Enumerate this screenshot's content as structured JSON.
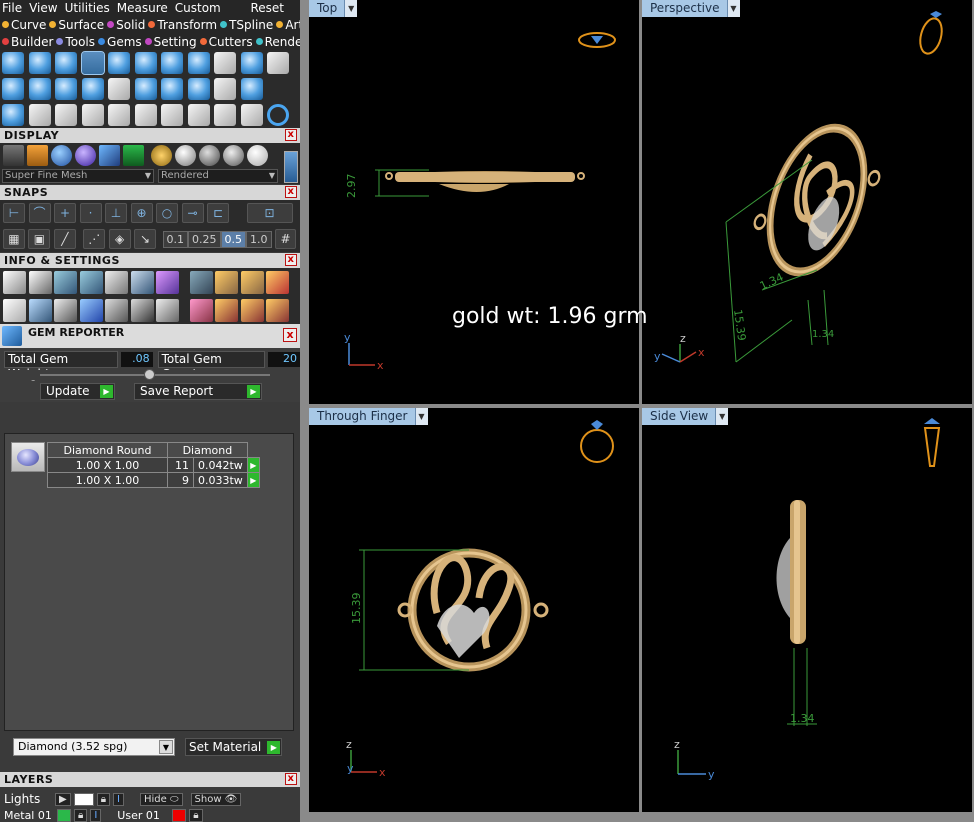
{
  "menubar": {
    "items": [
      "File",
      "View",
      "Utilities",
      "Measure",
      "Custom"
    ],
    "reset": "Reset"
  },
  "commands_row1": [
    {
      "label": "Curve",
      "color": "#f2b233"
    },
    {
      "label": "Surface",
      "color": "#f2b233"
    },
    {
      "label": "Solid",
      "color": "#c248c2"
    },
    {
      "label": "Transform",
      "color": "#f2693a"
    },
    {
      "label": "TSpline",
      "color": "#3fc1c9"
    },
    {
      "label": "Art",
      "color": "#f2b233"
    }
  ],
  "commands_row2": [
    {
      "label": "Builder",
      "color": "#e24040"
    },
    {
      "label": "Tools",
      "color": "#8a8ae0"
    },
    {
      "label": "Gems",
      "color": "#3a8ae0"
    },
    {
      "label": "Setting",
      "color": "#c248c2"
    },
    {
      "label": "Cutters",
      "color": "#f2693a"
    },
    {
      "label": "Render",
      "color": "#3fc1c9"
    }
  ],
  "display": {
    "title": "DISPLAY",
    "mesh_select": "Super Fine Mesh",
    "render_select": "Rendered"
  },
  "snaps": {
    "title": "SNAPS",
    "values": [
      "0.1",
      "0.25",
      "0.5",
      "1.0"
    ],
    "active_value": "0.5"
  },
  "info": {
    "title": "INFO & SETTINGS"
  },
  "gem_reporter": {
    "title": "GEM REPORTER",
    "total_weight_label": "Total Gem Weight",
    "total_weight": ".08",
    "total_count_label": "Total Gem Count",
    "total_count": "20",
    "update_label": "Update",
    "save_report_label": "Save Report",
    "table": {
      "headers": [
        "Diamond Round",
        "Diamond"
      ],
      "rows": [
        {
          "size": "1.00 X 1.00",
          "count": "11",
          "weight": "0.042tw"
        },
        {
          "size": "1.00 X 1.00",
          "count": "9",
          "weight": "0.033tw"
        }
      ]
    },
    "material": "Diamond    (3.52 spg)",
    "set_material_label": "Set Material"
  },
  "layers": {
    "title": "LAYERS",
    "lights_label": "Lights",
    "hide_label": "Hide",
    "show_label": "Show",
    "metal_label": "Metal 01",
    "user_label": "User 01"
  },
  "viewports": {
    "top": {
      "label": "Top",
      "dimension": "2.97"
    },
    "perspective": {
      "label": "Perspective",
      "dimension_a": "15.39",
      "dimension_b": "1.34",
      "dimension_c": "1.34"
    },
    "through_finger": {
      "label": "Through Finger",
      "dimension": "15.39"
    },
    "side": {
      "label": "Side View",
      "dimension": "1.34"
    }
  },
  "annotation": "gold wt: 1.96 grm",
  "colors": {
    "gold": "#d6b27a",
    "dimension": "#3a9a3a",
    "tab": "#a8c8e6",
    "axis": "#4a8ad8"
  }
}
